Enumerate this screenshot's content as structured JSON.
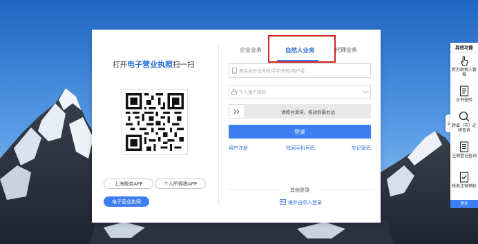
{
  "left": {
    "title_prefix": "打开",
    "title_highlight": "电子营业执照",
    "title_suffix": "扫一扫",
    "buttons": {
      "shanghai_app": "上海税务APP",
      "personal_tax_app": "个人所得税APP",
      "business_license": "电子营业执照"
    }
  },
  "tabs": {
    "enterprise": "企业业务",
    "natural_person": "自然人业务",
    "agent": "代理业务",
    "active": "natural_person"
  },
  "form": {
    "user_placeholder": "居民身份证号码/手机号码/用户名",
    "password_placeholder": "个人用户密码",
    "slider_hint": "请按住滑块，拖动到最右边",
    "login_label": "登录"
  },
  "links": {
    "register": "用户注册",
    "find_phone": "找回手机号码",
    "forgot_password": "忘记密码"
  },
  "other": {
    "title": "其他登录",
    "foreign_login": "境外自然人登录"
  },
  "sidebar": {
    "title": "其他功能",
    "items": [
      {
        "label": "新办纳税人套餐",
        "icon": "hand-pointer-icon"
      },
      {
        "label": "文书查验",
        "icon": "document-icon"
      },
      {
        "label": "跨省（市）迁移查询",
        "icon": "search-icon"
      },
      {
        "label": "注销登记查询",
        "icon": "register-icon"
      },
      {
        "label": "税务注销预检",
        "icon": "check-document-icon"
      }
    ],
    "more": "更多"
  },
  "colors": {
    "accent": "#3d7ef2",
    "highlight_border": "#d62020"
  }
}
